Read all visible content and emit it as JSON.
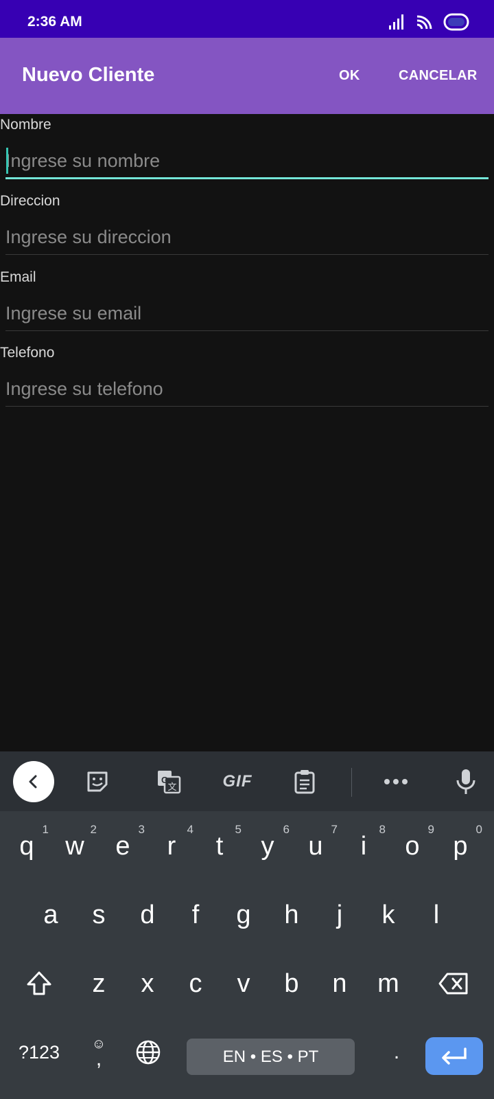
{
  "status_bar": {
    "time": "2:36 AM",
    "icons": [
      "signal-icon",
      "wifi-icon",
      "battery-icon"
    ]
  },
  "app_bar": {
    "title": "Nuevo Cliente",
    "ok_label": "OK",
    "cancel_label": "CANCELAR",
    "color": "#8455c2"
  },
  "form": {
    "fields": [
      {
        "label": "Nombre",
        "placeholder": "Ingrese su nombre",
        "value": "",
        "focused": true
      },
      {
        "label": "Direccion",
        "placeholder": "Ingrese su direccion",
        "value": "",
        "focused": false
      },
      {
        "label": "Email",
        "placeholder": "Ingrese su email",
        "value": "",
        "focused": false
      },
      {
        "label": "Telefono",
        "placeholder": "Ingrese su telefono",
        "value": "",
        "focused": false
      }
    ],
    "accent_color": "#74e6d8"
  },
  "keyboard": {
    "toolbar_icons": [
      "back-chevron-icon",
      "sticker-icon",
      "translate-icon",
      "gif-icon",
      "clipboard-icon",
      "more-icon",
      "mic-icon"
    ],
    "gif_label": "GIF",
    "row1": [
      {
        "key": "q",
        "hint": "1"
      },
      {
        "key": "w",
        "hint": "2"
      },
      {
        "key": "e",
        "hint": "3"
      },
      {
        "key": "r",
        "hint": "4"
      },
      {
        "key": "t",
        "hint": "5"
      },
      {
        "key": "y",
        "hint": "6"
      },
      {
        "key": "u",
        "hint": "7"
      },
      {
        "key": "i",
        "hint": "8"
      },
      {
        "key": "o",
        "hint": "9"
      },
      {
        "key": "p",
        "hint": "0"
      }
    ],
    "row2": [
      "a",
      "s",
      "d",
      "f",
      "g",
      "h",
      "j",
      "k",
      "l"
    ],
    "row3": [
      "z",
      "x",
      "c",
      "v",
      "b",
      "n",
      "m"
    ],
    "symbols_label": "?123",
    "comma_label": ",",
    "space_label": "EN • ES • PT",
    "period_label": ".",
    "enter_color": "#5b97f0"
  }
}
